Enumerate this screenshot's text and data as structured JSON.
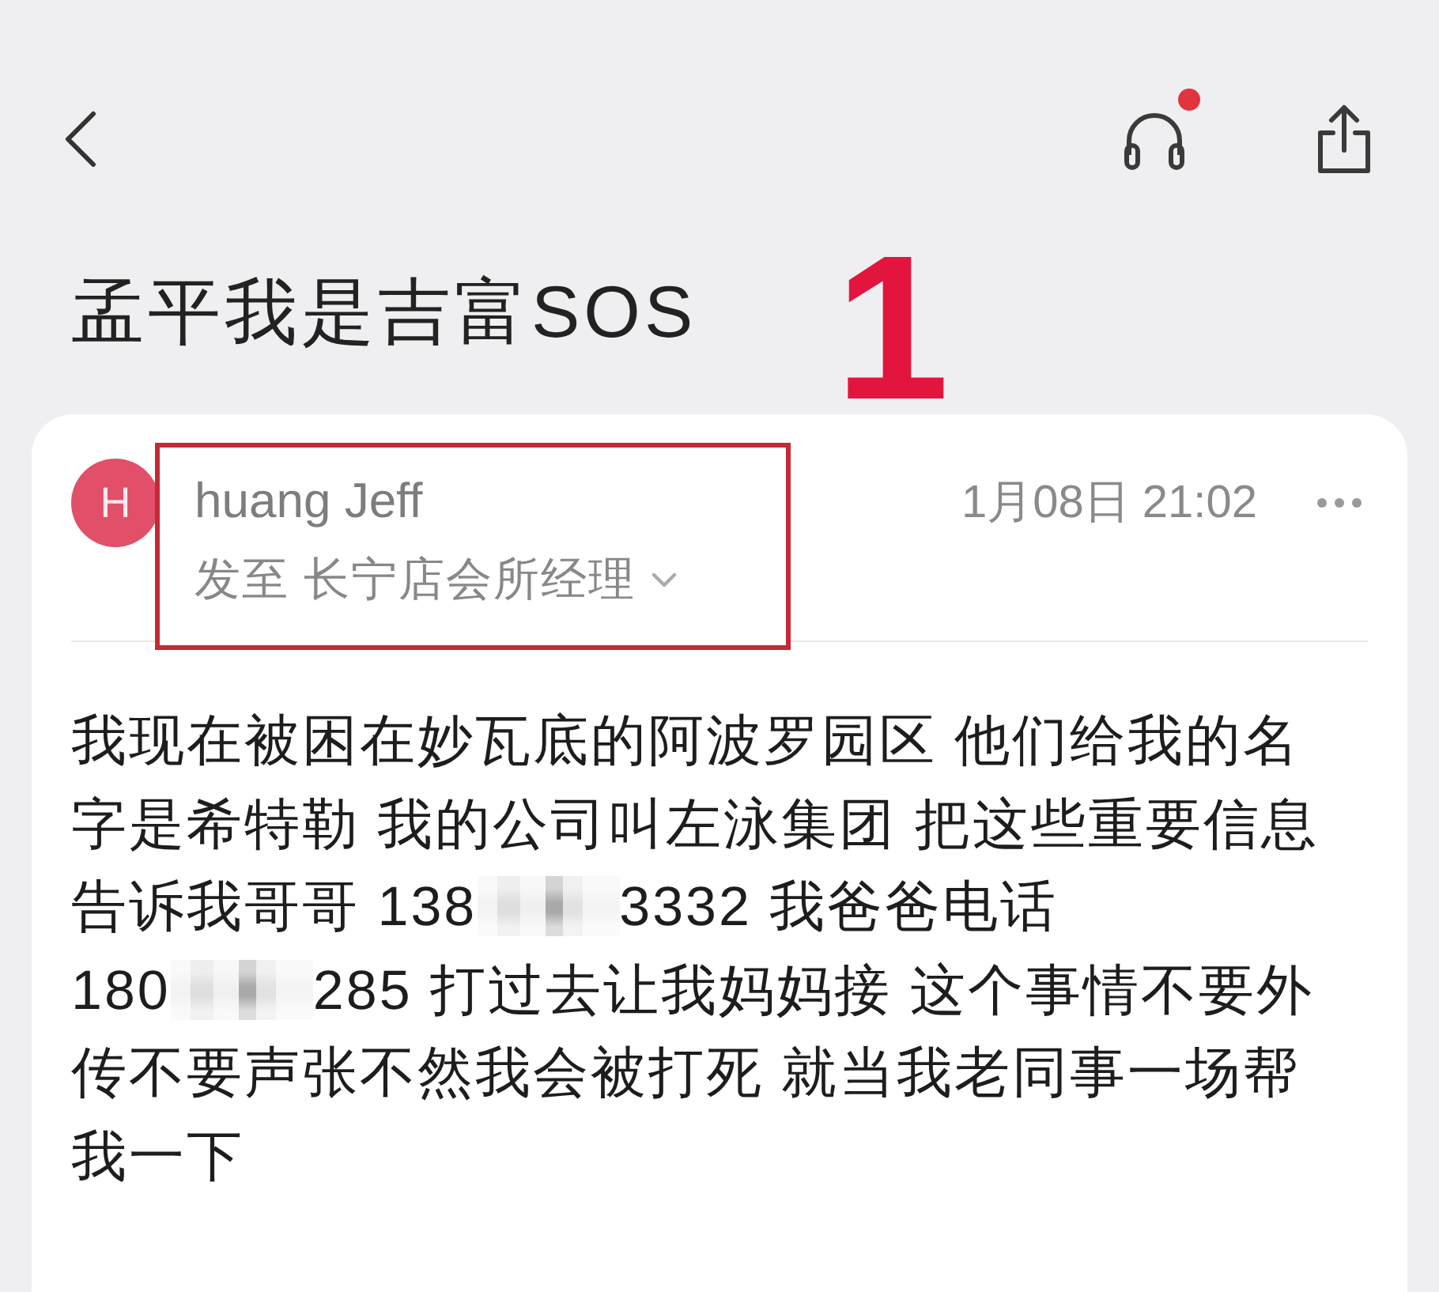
{
  "toolbar": {
    "audio_badge": true
  },
  "subject": "孟平我是吉富SOS",
  "annotation": {
    "label": "1",
    "sender_framed": true
  },
  "message": {
    "avatar_initial": "H",
    "sender": "huang Jeff",
    "recipient_line": "发至 长宁店会所经理",
    "date": "1月08日 21:02",
    "body_lines": [
      [
        {
          "kind": "text",
          "text": "我现在被困在妙瓦底的阿波罗园区 他们给我的名"
        }
      ],
      [
        {
          "kind": "text",
          "text": "字是希特勒 我的公司叫左泳集团 把这些重要信息"
        }
      ],
      [
        {
          "kind": "text",
          "text": "告诉我哥哥 138"
        },
        {
          "kind": "blur"
        },
        {
          "kind": "text",
          "text": "3332 我爸爸电话"
        }
      ],
      [
        {
          "kind": "text",
          "text": "180"
        },
        {
          "kind": "blur"
        },
        {
          "kind": "text",
          "text": "285 打过去让我妈妈接 这个事情不要外"
        }
      ],
      [
        {
          "kind": "text",
          "text": "传不要声张不然我会被打死 就当我老同事一场帮"
        }
      ],
      [
        {
          "kind": "text",
          "text": "我一下"
        }
      ]
    ]
  }
}
